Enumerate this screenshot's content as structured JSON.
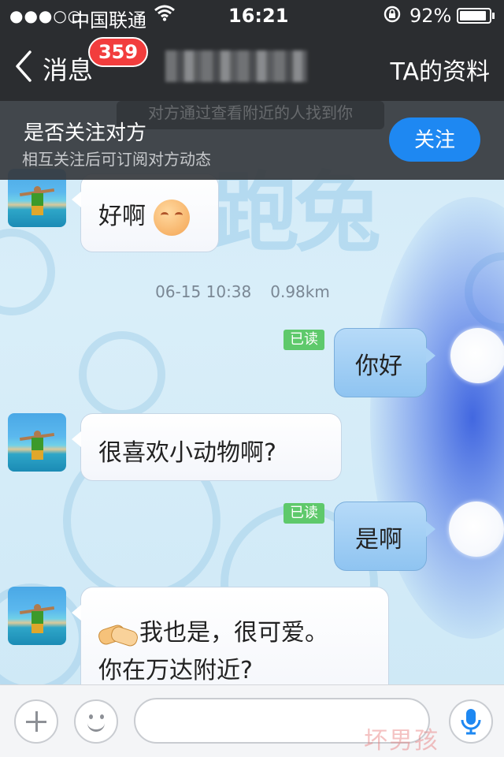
{
  "status_bar": {
    "signal": "●●●○○",
    "carrier": "中国联通",
    "wifi_icon": "wifi-icon",
    "time": "16:21",
    "lock_icon": "rotation-lock-icon",
    "battery_text": "92%",
    "battery_level": 0.92
  },
  "nav": {
    "back_label": "消息",
    "badge": "359",
    "profile_label": "TA的资料"
  },
  "banner": {
    "hint_text": "对方通过查看附近的人找到你",
    "title": "是否关注对方",
    "subtitle": "相互关注后可订阅对方动态",
    "follow_label": "关注"
  },
  "background_text": "跑兔",
  "messages": {
    "m1": {
      "text": "好啊"
    },
    "timestamp": {
      "time": "06-15 10:38",
      "distance": "0.98km"
    },
    "m2": {
      "text": "你好",
      "read": "已读"
    },
    "m3": {
      "text": "很喜欢小动物啊?"
    },
    "m4": {
      "text": "是啊",
      "read": "已读"
    },
    "m5": {
      "line1": "我也是，很可爱。",
      "line2": "你在万达附近?"
    }
  },
  "input_bar": {
    "placeholder": ""
  },
  "watermark": "坏男孩",
  "colors": {
    "nav_bg": "#2b2d30",
    "follow_button": "#1e88f2",
    "badge": "#f23d3d",
    "read_tag": "#5ec96b"
  }
}
